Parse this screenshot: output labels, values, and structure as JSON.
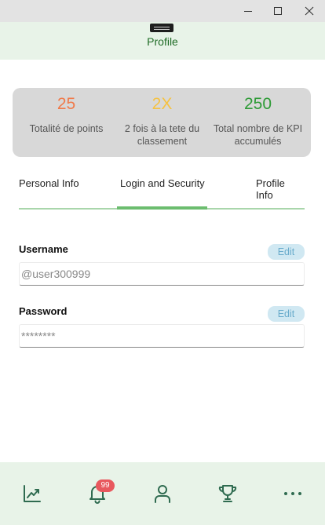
{
  "window": {
    "controls": [
      "minimize-icon",
      "maximize-icon",
      "close-icon"
    ]
  },
  "header": {
    "title": "Profile",
    "title_color": "#1e6b25",
    "background": "#e8f3e8"
  },
  "stats": [
    {
      "value": "25",
      "label": "Totalité de points",
      "color": "#f07a4a"
    },
    {
      "value": "2X",
      "label": "2 fois à la tete du classement",
      "color": "#f5c242"
    },
    {
      "value": "250",
      "label": "Total nombre de KPI accumulés",
      "color": "#2e9b37"
    }
  ],
  "tabs": {
    "items": [
      {
        "label": "Personal Info",
        "active": false
      },
      {
        "label": "Login and Security",
        "active": true
      },
      {
        "label": "Profile Info",
        "active": false
      }
    ],
    "accent": "#6cbd6f"
  },
  "fields": {
    "username": {
      "label": "Username",
      "edit_label": "Edit",
      "placeholder": "@user300999"
    },
    "password": {
      "label": "Password",
      "edit_label": "Edit",
      "placeholder": "********"
    }
  },
  "bottom_nav": {
    "items": [
      {
        "icon": "chart-trend-icon"
      },
      {
        "icon": "bell-icon",
        "badge": "99"
      },
      {
        "icon": "person-icon"
      },
      {
        "icon": "trophy-icon"
      },
      {
        "icon": "more-icon"
      }
    ],
    "icon_color": "#2f6b50",
    "badge_color": "#e8585e"
  }
}
